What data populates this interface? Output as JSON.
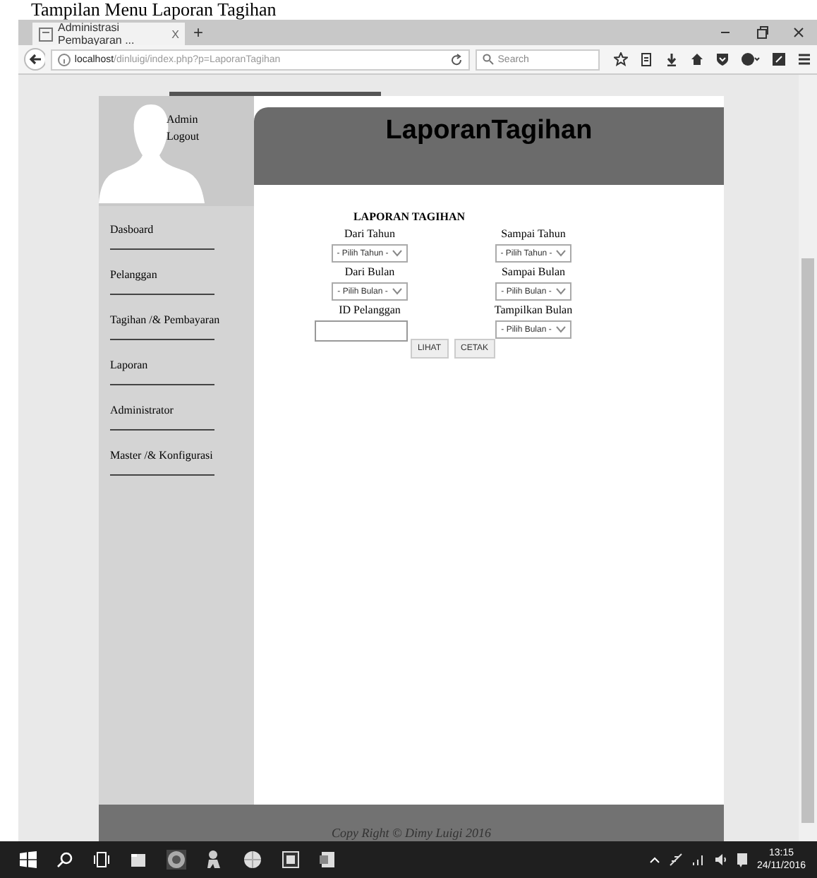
{
  "caption": "Tampilan Menu Laporan Tagihan",
  "browser": {
    "tab_title": "Administrasi Pembayaran ...",
    "tab_close": "X",
    "new_tab": "+",
    "url_host": "localhost",
    "url_path": "/dinluigi/index.php?p=LaporanTagihan",
    "search_placeholder": "Search"
  },
  "user": {
    "name": "Admin",
    "logout": "Logout"
  },
  "menu": [
    {
      "label": "Dasboard"
    },
    {
      "label": "Pelanggan"
    },
    {
      "label": "Tagihan /& Pembayaran"
    },
    {
      "label": "Laporan"
    },
    {
      "label": "Administrator"
    },
    {
      "label": "Master /& Konfigurasi"
    }
  ],
  "header": {
    "title": "LaporanTagihan"
  },
  "form": {
    "title": "LAPORAN TAGIHAN",
    "fields": [
      {
        "label": "Dari Tahun",
        "kind": "select",
        "value": "- Pilih Tahun -"
      },
      {
        "label": "Sampai Tahun",
        "kind": "select",
        "value": "- Pilih Tahun -"
      },
      {
        "label": "Dari Bulan",
        "kind": "select",
        "value": "- Pilih Bulan -"
      },
      {
        "label": "Sampai Bulan",
        "kind": "select",
        "value": "- Pilih Bulan -"
      },
      {
        "label": "ID Pelanggan",
        "kind": "text"
      },
      {
        "label": "Tampilkan Bulan",
        "kind": "select",
        "value": "- Pilih Bulan -"
      }
    ],
    "buttons": [
      "LIHAT",
      "CETAK"
    ]
  },
  "footer": "Copy Right © Dimy Luigi 2016",
  "taskbar": {
    "time": "13:15",
    "date": "24/11/2016"
  }
}
